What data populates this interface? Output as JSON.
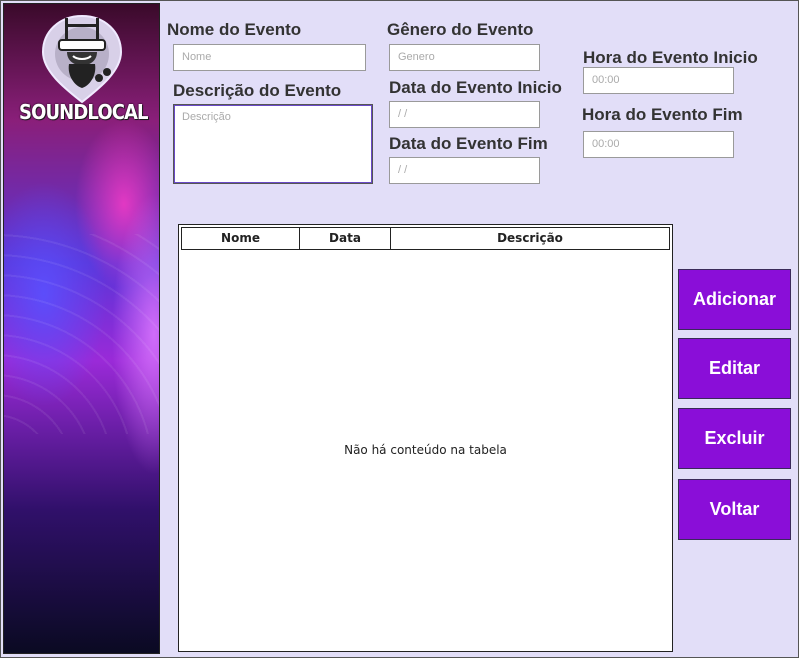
{
  "brand": {
    "name": "SOUNDLOCAL"
  },
  "form": {
    "nome": {
      "label": "Nome do Evento",
      "placeholder": "Nome"
    },
    "descricao": {
      "label": "Descrição do Evento",
      "placeholder": "Descrição"
    },
    "genero": {
      "label": "Gênero do Evento",
      "placeholder": "Genero"
    },
    "data_inicio": {
      "label": "Data do Evento Inicio",
      "value": " /  /"
    },
    "data_fim": {
      "label": "Data do Evento Fim",
      "value": " /  /"
    },
    "hora_inicio": {
      "label": "Hora do Evento Inicio",
      "value": "00:00"
    },
    "hora_fim": {
      "label": "Hora do Evento Fim",
      "value": "00:00"
    }
  },
  "table": {
    "columns": [
      "Nome",
      "Data",
      "Descrição"
    ],
    "empty_text": "Não há conteúdo na tabela"
  },
  "buttons": {
    "add": "Adicionar",
    "edit": "Editar",
    "delete": "Excluir",
    "back": "Voltar"
  },
  "colors": {
    "button_bg": "#8a0ed8",
    "page_bg": "#e2def8"
  },
  "icons": {
    "logo": "headphone-pin-logo-icon"
  }
}
